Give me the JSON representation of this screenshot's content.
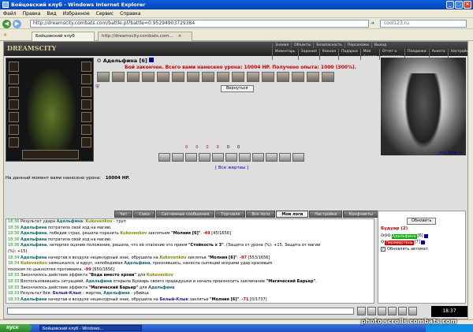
{
  "window": {
    "title": "Бойцовский клуб - Windows Internet Explorer"
  },
  "menu": [
    "Файл",
    "Правка",
    "Вид",
    "Избранное",
    "Сервис",
    "Справка"
  ],
  "address": {
    "url": "http://dreamscity.combats.com/battle.pl?battle=0.95294903729384",
    "search_placeholder": "cool123.ru"
  },
  "tabs": [
    {
      "label": "Бойцовский клуб"
    },
    {
      "label": "http://dreamscity.combats.com..."
    }
  ],
  "site": {
    "logo": "DREAMSCITY",
    "nav_top": [
      "Знания",
      "Объекты",
      "Безопасность",
      "Персонажи",
      "Выход"
    ],
    "nav_bottom": [
      "Инвентарь",
      "Задания",
      "Умения",
      "Подарки",
      "Мой Скролл",
      "Отчет о переводах",
      "Поединки",
      "Анкета",
      "Настройки"
    ]
  },
  "character": {
    "name": "Адельфина",
    "level": "[6]"
  },
  "battle": {
    "result_text": "Бой закончен. Всего вами нанесено урона: 10004 HP. Получено опыта: 1000 (300%).",
    "return_button": "Вернуться",
    "stats": [
      "0",
      "0",
      "0",
      "0",
      "0",
      "0"
    ],
    "all_victims_link": "[ Все жертвы ]",
    "log_link": "лог боя »»",
    "damage_line": "На данный момент вами нанесено урона:",
    "damage_value": "10004 HP."
  },
  "chat_tabs": [
    "Чат",
    "Союз",
    "Системные сообщения",
    "Торговля",
    "Все логи",
    "Мои логи",
    "Настройки",
    "Конфликты"
  ],
  "chat_active_tab": "Мои логи",
  "chat_lines": [
    {
      "t": "18:36",
      "parts": [
        [
          "",
          "Результат удара "
        ],
        [
          "nm-a",
          "Адельфина"
        ],
        [
          "",
          ": "
        ],
        [
          "nm-k",
          "Kukovenkov"
        ],
        [
          "",
          " - труп"
        ]
      ]
    },
    {
      "t": "18:36",
      "parts": [
        [
          "nm-a",
          "Адельфина"
        ],
        [
          "",
          " потратила свой ход на магию."
        ]
      ]
    },
    {
      "t": "18:36",
      "parts": [
        [
          "nm-a",
          "Адельфина"
        ],
        [
          "",
          ", победив страх, решила поразить "
        ],
        [
          "nm-k",
          "Kukovenkov"
        ],
        [
          "",
          " заклятьем "
        ],
        [
          "spell",
          "\"Молния [6]\""
        ],
        [
          "",
          ". "
        ],
        [
          "hit",
          "-49"
        ],
        [
          "",
          " [45/1656]"
        ]
      ]
    },
    {
      "t": "18:36",
      "parts": [
        [
          "nm-a",
          "Адельфина"
        ],
        [
          "",
          " потратила свой ход на магию."
        ]
      ]
    },
    {
      "t": "18:36",
      "parts": [
        [
          "nm-a",
          "Адельфина"
        ],
        [
          "",
          ", нетерпео оценив положение, решила, что её спасение это прием "
        ],
        [
          "spell",
          "\"Стойкость х 3\""
        ],
        [
          "",
          ". (Защита от урона (%): +15, Защита от магии"
        ]
      ]
    },
    {
      "t": "",
      "parts": [
        [
          "",
          "(%): +15)"
        ]
      ]
    },
    {
      "t": "18:34",
      "parts": [
        [
          "nm-a",
          "Адельфина"
        ],
        [
          "",
          " начертав в воздухе нецензурный знак, обрушила на "
        ],
        [
          "nm-k",
          "Kukovenkov"
        ],
        [
          "",
          " заклятье "
        ],
        [
          "spell",
          "\"Молния [6]\""
        ],
        [
          "",
          ". "
        ],
        [
          "hit",
          "-97"
        ],
        [
          "",
          " [553/1656]"
        ]
      ]
    },
    {
      "t": "18:34",
      "parts": [
        [
          "nm-k",
          "Kukovenkov"
        ],
        [
          "",
          " замешкался, и вдруг, непобедимая "
        ],
        [
          "nm-a",
          "Адельфина"
        ],
        [
          "",
          ", проснявшись, нанесла сыпящий искрами удар красивым"
        ]
      ]
    },
    {
      "t": "",
      "parts": [
        [
          "",
          "посохом по цыкнолпке противника. "
        ],
        [
          "hit",
          "-99"
        ],
        [
          "",
          " [650/1656]"
        ]
      ]
    },
    {
      "t": "18:33",
      "parts": [
        [
          "",
          "Закончилось действие эффекта "
        ],
        [
          "spell",
          "\"Вода вместо крови\""
        ],
        [
          "",
          " для "
        ],
        [
          "nm-k",
          "Kukovenkov"
        ]
      ]
    },
    {
      "t": "18:33",
      "parts": [
        [
          "",
          "Воспользовавшись ситуацией, "
        ],
        [
          "nm-a",
          "Адельфина"
        ],
        [
          "",
          " открыла Букварь своего прадедушки и начала произносить заклинание "
        ],
        [
          "spell",
          "\"Магический Барьер\""
        ],
        [
          "",
          "."
        ]
      ]
    },
    {
      "t": "18:33",
      "parts": [
        [
          "",
          "Закончилось действие эффекта "
        ],
        [
          "spell",
          "\"Магический Барьер\""
        ],
        [
          "",
          " для "
        ],
        [
          "nm-a",
          "Адельфина"
        ]
      ]
    },
    {
      "t": "18:33",
      "parts": [
        [
          "",
          "Результат боя: "
        ],
        [
          "nm-b",
          "Белый-Клык"
        ],
        [
          "",
          " - жертва, "
        ],
        [
          "nm-a",
          "Адельфина"
        ],
        [
          "",
          " - убийца"
        ]
      ]
    },
    {
      "t": "18:33",
      "parts": [
        [
          "nm-a",
          "Адельфина"
        ],
        [
          "",
          " начертав в воздухе нецензурный знак, обрушила на "
        ],
        [
          "nm-b",
          "Белый-Клык"
        ],
        [
          "",
          " заклятье "
        ],
        [
          "spell",
          "\"Молния [6]\""
        ],
        [
          "",
          ". "
        ],
        [
          "hit",
          "-71"
        ],
        [
          "",
          " [0/1737]"
        ]
      ]
    }
  ],
  "side_panel": {
    "refresh_button": "Обновить",
    "room_title": "Будуар (2)",
    "players": [
      {
        "name": "Адельфина",
        "level": "[6]",
        "color": "#00b000"
      },
      {
        "name": "Перевертень",
        "level": "[7]",
        "color": "#d00000"
      }
    ],
    "auto_update_label": "Обновлять автомат."
  },
  "clock": "18:37",
  "status": {
    "zone": "Интернет",
    "zoom": "100%"
  },
  "taskbar": {
    "start": "пуск",
    "task": "Бойцовский клуб - Windows..."
  },
  "watermark": "photo.scrolls.combats.com",
  "colors": {
    "titlebar": "#0a5ee0",
    "damage": "#c00000",
    "time": "#009900",
    "link": "#0000cc"
  }
}
